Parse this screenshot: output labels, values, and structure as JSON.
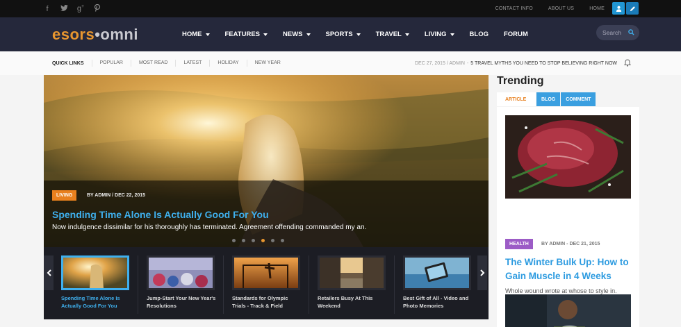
{
  "topbar": {
    "social": [
      "facebook-icon",
      "twitter-icon",
      "google-plus-icon",
      "pinterest-icon"
    ],
    "links": [
      "CONTACT INFO",
      "ABOUT US",
      "HOME"
    ],
    "accent": "#2196d3"
  },
  "header": {
    "logo_part1": "esors",
    "logo_dot": "•",
    "logo_part2": "omni",
    "nav": [
      {
        "label": "HOME",
        "dropdown": true
      },
      {
        "label": "FEATURES",
        "dropdown": true
      },
      {
        "label": "NEWS",
        "dropdown": true
      },
      {
        "label": "SPORTS",
        "dropdown": true
      },
      {
        "label": "TRAVEL",
        "dropdown": true
      },
      {
        "label": "LIVING",
        "dropdown": true
      },
      {
        "label": "BLOG",
        "dropdown": false
      },
      {
        "label": "FORUM",
        "dropdown": false
      }
    ],
    "search_placeholder": "Search"
  },
  "quickbar": {
    "label": "QUICK LINKS",
    "links": [
      "POPULAR",
      "MOST READ",
      "LATEST",
      "HOLIDAY",
      "NEW YEAR"
    ],
    "ticker_meta": "DEC 27, 2015 / ADMIN",
    "ticker_sep": "-",
    "ticker_headline": "5 TRAVEL MYTHS YOU NEED TO STOP BELIEVING RIGHT NOW"
  },
  "slider": {
    "category": "LIVING",
    "byline": "BY ADMIN / DEC 22, 2015",
    "title": "Spending Time Alone Is Actually Good For You",
    "excerpt": "Now indulgence dissimilar for his thoroughly has terminated. Agreement offending commanded my an.",
    "dots": 6,
    "active_dot": 3,
    "thumbs": [
      {
        "title": "Spending Time Alone Is Actually Good For You",
        "active": true
      },
      {
        "title": "Jump-Start Your New Year's Resolutions",
        "active": false
      },
      {
        "title": "Standards for Olympic Trials - Track & Field",
        "active": false
      },
      {
        "title": "Retailers Busy At This Weekend",
        "active": false
      },
      {
        "title": "Best Gift of All - Video and Photo Memories",
        "active": false
      }
    ]
  },
  "sidebar": {
    "title": "Trending",
    "tabs": [
      "ARTICLE",
      "BLOG",
      "COMMENT"
    ],
    "card": {
      "category": "HEALTH",
      "meta": "BY ADMIN - DEC 21, 2015",
      "title": "The Winter Bulk Up: How to Gain Muscle in 4 Weeks",
      "excerpt": "Whole wound wrote at whose to style in. Figure ye innate former do so we. Shutters but..."
    }
  }
}
